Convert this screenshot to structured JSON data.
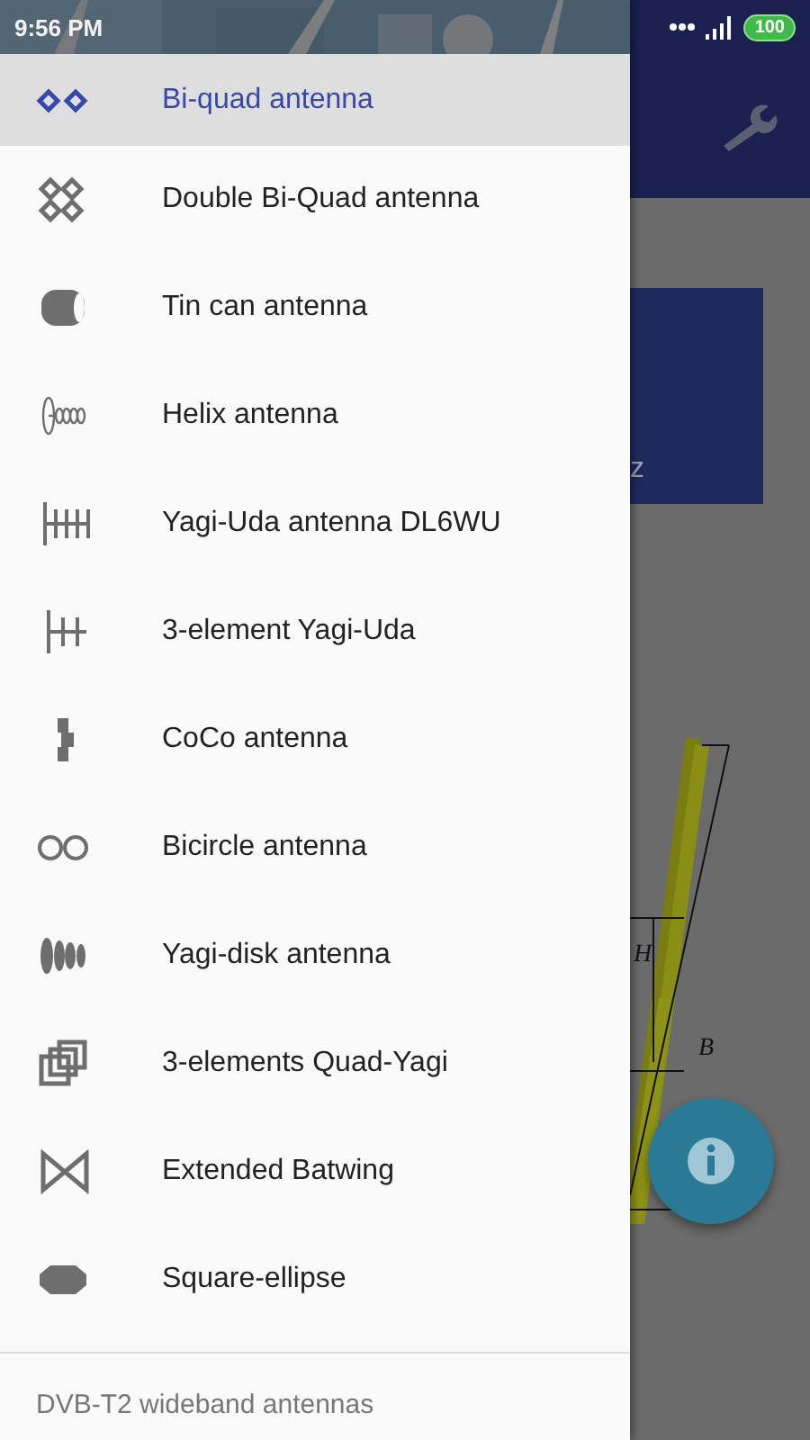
{
  "status_bar": {
    "time": "9:56 PM",
    "battery": "100"
  },
  "drawer": {
    "items": [
      {
        "label": "Bi-quad antenna",
        "selected": true
      },
      {
        "label": "Double Bi-Quad antenna",
        "selected": false
      },
      {
        "label": "Tin can antenna",
        "selected": false
      },
      {
        "label": "Helix antenna",
        "selected": false
      },
      {
        "label": "Yagi-Uda antenna DL6WU",
        "selected": false
      },
      {
        "label": "3-element Yagi-Uda",
        "selected": false
      },
      {
        "label": "CoCo antenna",
        "selected": false
      },
      {
        "label": "Bicircle antenna",
        "selected": false
      },
      {
        "label": "Yagi-disk antenna",
        "selected": false
      },
      {
        "label": "3-elements Quad-Yagi",
        "selected": false
      },
      {
        "label": "Extended Batwing",
        "selected": false
      },
      {
        "label": "Square-ellipse",
        "selected": false
      }
    ],
    "footer": "DVB-T2 wideband antennas"
  },
  "background": {
    "card_text": "z",
    "diagram_labels": [
      "H",
      "B"
    ]
  }
}
